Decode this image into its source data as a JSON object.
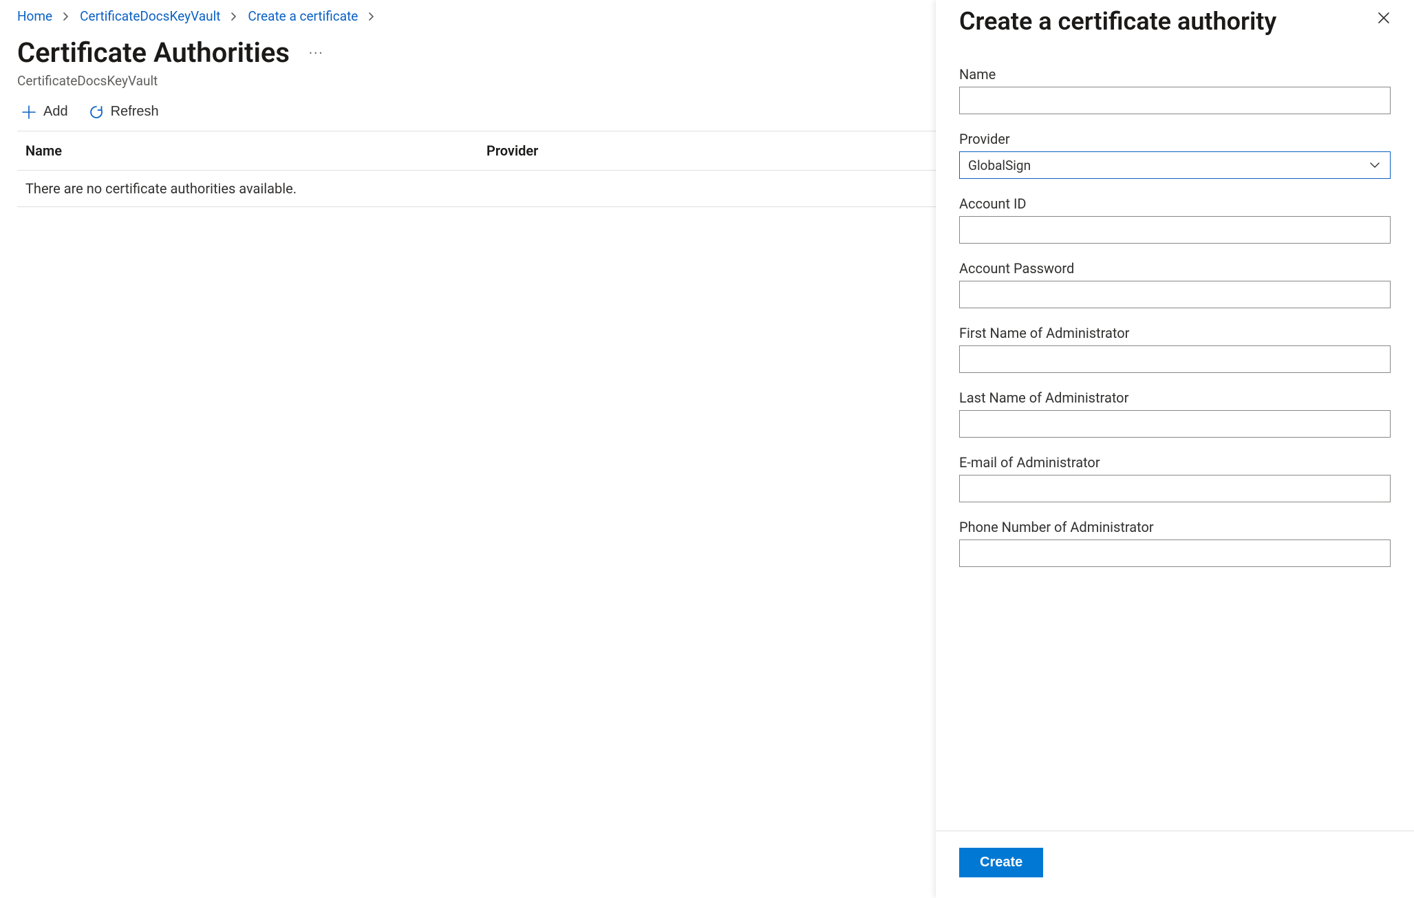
{
  "breadcrumb": {
    "items": [
      {
        "label": "Home"
      },
      {
        "label": "CertificateDocsKeyVault"
      },
      {
        "label": "Create a certificate"
      }
    ]
  },
  "header": {
    "title": "Certificate Authorities",
    "subtitle": "CertificateDocsKeyVault"
  },
  "toolbar": {
    "add_label": "Add",
    "refresh_label": "Refresh"
  },
  "table": {
    "columns": {
      "name": "Name",
      "provider": "Provider"
    },
    "empty_message": "There are no certificate authorities available."
  },
  "panel": {
    "title": "Create a certificate authority",
    "fields": {
      "name": {
        "label": "Name",
        "value": ""
      },
      "provider": {
        "label": "Provider",
        "value": "GlobalSign"
      },
      "account_id": {
        "label": "Account ID",
        "value": ""
      },
      "account_password": {
        "label": "Account Password",
        "value": ""
      },
      "admin_first_name": {
        "label": "First Name of Administrator",
        "value": ""
      },
      "admin_last_name": {
        "label": "Last Name of Administrator",
        "value": ""
      },
      "admin_email": {
        "label": "E-mail of Administrator",
        "value": ""
      },
      "admin_phone": {
        "label": "Phone Number of Administrator",
        "value": ""
      }
    },
    "create_label": "Create"
  }
}
